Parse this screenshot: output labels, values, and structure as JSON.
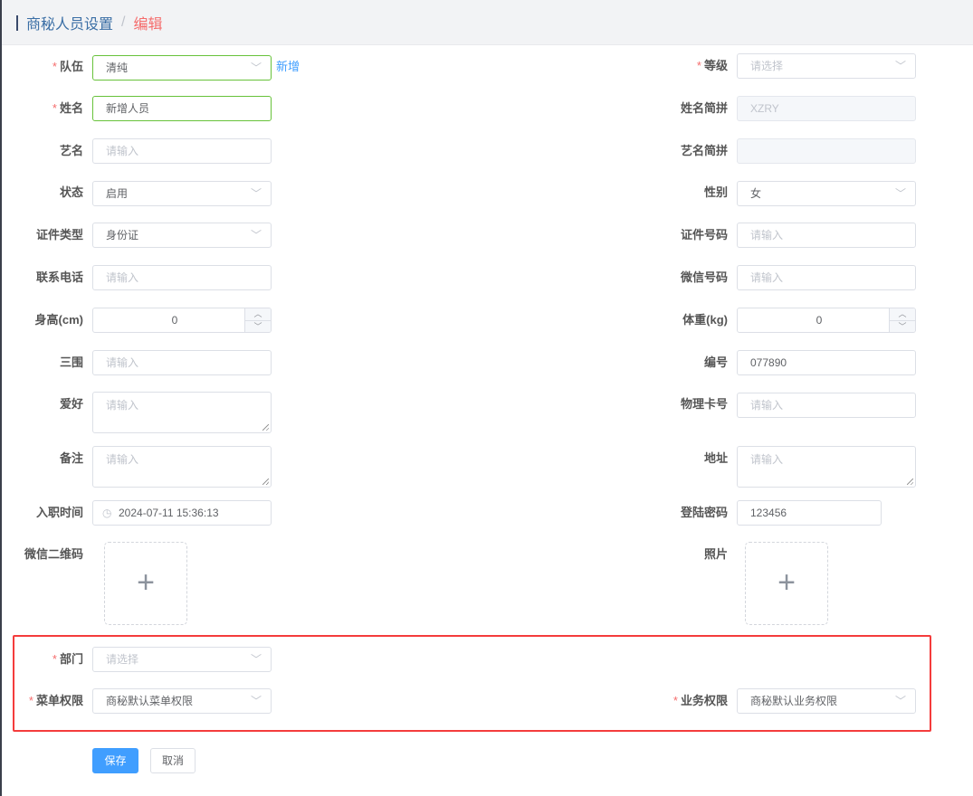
{
  "breadcrumb": {
    "parent": "商秘人员设置",
    "separator": "/",
    "current": "编辑"
  },
  "form": {
    "team": {
      "label": "队伍",
      "value": "清纯",
      "add_link": "新增"
    },
    "level": {
      "label": "等级",
      "placeholder": "请选择"
    },
    "name": {
      "label": "姓名",
      "value": "新增人员"
    },
    "name_pinyin": {
      "label": "姓名简拼",
      "value": "XZRY"
    },
    "stage_name": {
      "label": "艺名",
      "placeholder": "请输入"
    },
    "stage_pinyin": {
      "label": "艺名简拼",
      "value": ""
    },
    "status": {
      "label": "状态",
      "value": "启用"
    },
    "gender": {
      "label": "性别",
      "value": "女"
    },
    "id_type": {
      "label": "证件类型",
      "value": "身份证"
    },
    "id_number": {
      "label": "证件号码",
      "placeholder": "请输入"
    },
    "phone": {
      "label": "联系电话",
      "placeholder": "请输入"
    },
    "wechat": {
      "label": "微信号码",
      "placeholder": "请输入"
    },
    "height": {
      "label": "身高(cm)",
      "value": "0"
    },
    "weight": {
      "label": "体重(kg)",
      "value": "0"
    },
    "measurements": {
      "label": "三围",
      "placeholder": "请输入"
    },
    "code": {
      "label": "编号",
      "value": "077890"
    },
    "hobby": {
      "label": "爱好",
      "placeholder": "请输入"
    },
    "card_no": {
      "label": "物理卡号",
      "placeholder": "请输入"
    },
    "remark": {
      "label": "备注",
      "placeholder": "请输入"
    },
    "address": {
      "label": "地址",
      "placeholder": "请输入"
    },
    "hire_date": {
      "label": "入职时间",
      "value": "2024-07-11 15:36:13"
    },
    "password": {
      "label": "登陆密码",
      "value": "123456"
    },
    "wechat_qr": {
      "label": "微信二维码",
      "upload_symbol": "+"
    },
    "photo": {
      "label": "照片",
      "upload_symbol": "+"
    },
    "department": {
      "label": "部门",
      "placeholder": "请选择"
    },
    "menu_permission": {
      "label": "菜单权限",
      "value": "商秘默认菜单权限"
    },
    "business_permission": {
      "label": "业务权限",
      "value": "商秘默认业务权限"
    }
  },
  "buttons": {
    "save": "保存",
    "cancel": "取消"
  },
  "icons": {
    "select": "chevron-down-icon",
    "date": "clock-icon",
    "upload": "plus-icon",
    "spin_up": "chevron-up-icon",
    "spin_down": "chevron-down-icon"
  },
  "colors": {
    "required": "#f56c6c",
    "link": "#409eff",
    "primary": "#409eff",
    "highlight_box": "#f43c3c",
    "active_border": "#67c23a"
  }
}
